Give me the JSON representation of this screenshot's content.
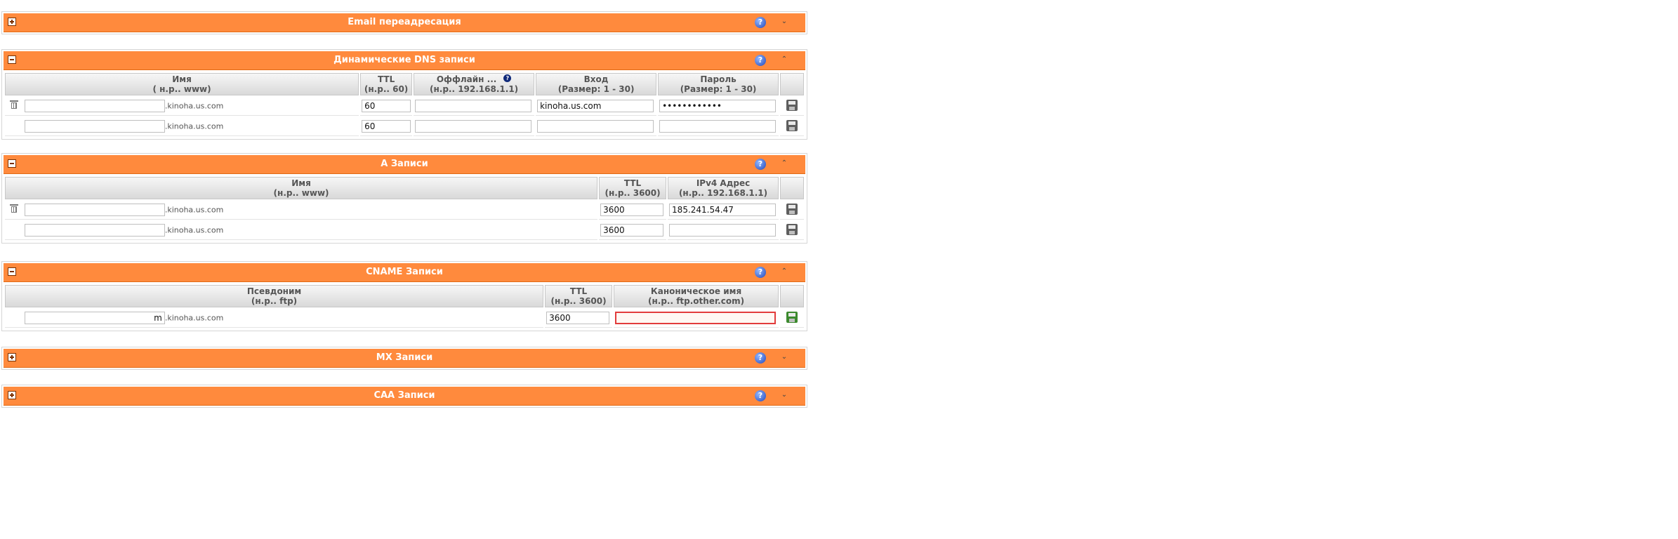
{
  "sections": {
    "email_forwarding": {
      "title": "Email переадресация",
      "toggle": "+",
      "help_label": "?",
      "chevron": "⌄"
    },
    "dyn_dns": {
      "title": "Динамические DNS записи",
      "toggle": "−",
      "help_label": "?",
      "chevron": "⌃",
      "headers": {
        "name": "Имя",
        "name_hint": "( н.р.. www)",
        "ttl": "TTL",
        "ttl_hint": "(н.р.. 60)",
        "offline": "Оффлайн ...",
        "offline_hint": "(н.р.. 192.168.1.1)",
        "offline_help": "?",
        "login": "Вход",
        "login_hint": "(Размер: 1 - 30)",
        "password": "Пароль",
        "password_hint": "(Размер: 1 - 30)"
      },
      "rows": [
        {
          "name": "",
          "suffix": ".kinoha.us.com",
          "ttl": "60",
          "offline": "",
          "login": "kinoha.us.com",
          "password": "••••••••••••"
        },
        {
          "name": "",
          "suffix": ".kinoha.us.com",
          "ttl": "60",
          "offline": "",
          "login": "",
          "password": ""
        }
      ]
    },
    "a_records": {
      "title": "A Записи",
      "toggle": "−",
      "help_label": "?",
      "chevron": "⌃",
      "headers": {
        "name": "Имя",
        "name_hint": "(н.р.. www)",
        "ttl": "TTL",
        "ttl_hint": "(н.р.. 3600)",
        "ipv4": "IPv4 Адрес",
        "ipv4_hint": "(н.р.. 192.168.1.1)"
      },
      "rows": [
        {
          "name": "",
          "suffix": ".kinoha.us.com",
          "ttl": "3600",
          "ip": "185.241.54.47"
        },
        {
          "name": "",
          "suffix": ".kinoha.us.com",
          "ttl": "3600",
          "ip": ""
        }
      ]
    },
    "cname": {
      "title": "CNAME Записи",
      "toggle": "−",
      "help_label": "?",
      "chevron": "⌃",
      "headers": {
        "alias": "Псевдоним",
        "alias_hint": "(н.р.. ftp)",
        "ttl": "TTL",
        "ttl_hint": "(н.р.. 3600)",
        "canonical": "Каноническое имя",
        "canonical_hint": "(н.р.. ftp.other.com)"
      },
      "rows": [
        {
          "alias": "m",
          "suffix": ".kinoha.us.com",
          "ttl": "3600",
          "canonical": ""
        }
      ]
    },
    "mx": {
      "title": "MX Записи",
      "toggle": "+",
      "help_label": "?",
      "chevron": "⌄"
    },
    "caa": {
      "title": "CAA Записи",
      "toggle": "+",
      "help_label": "?",
      "chevron": "⌄"
    }
  },
  "colors": {
    "bar": "#ff8a3d",
    "error_border": "#e23c3c",
    "save_active": "#3c8a2e"
  },
  "icons": [
    "expand-icon",
    "collapse-icon",
    "help-icon",
    "chevron-down-icon",
    "chevron-up-icon",
    "trash-icon",
    "save-icon"
  ]
}
